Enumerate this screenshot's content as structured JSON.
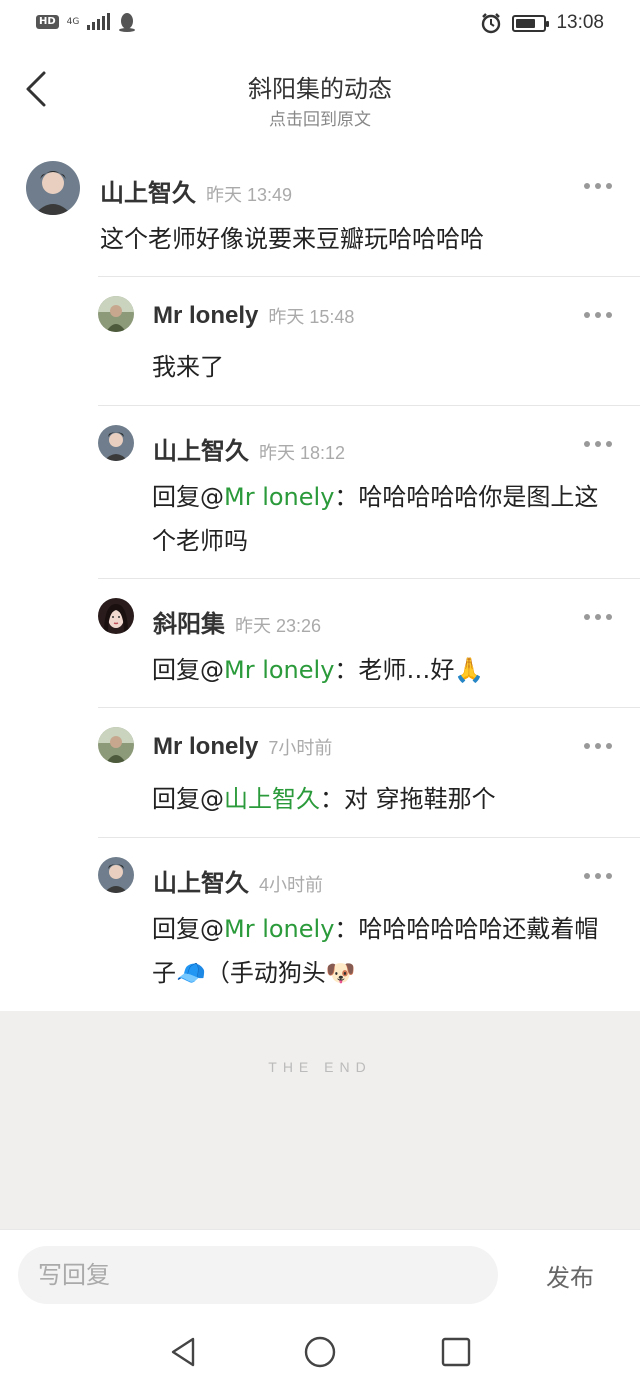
{
  "status_bar": {
    "hd": "HD",
    "network": "4G",
    "time": "13:08",
    "battery_level": 0.7
  },
  "header": {
    "title": "斜阳集的动态",
    "subtitle": "点击回到原文"
  },
  "main_comment": {
    "author": "山上智久",
    "time": "昨天 13:49",
    "text": "这个老师好像说要来豆瓣玩哈哈哈哈"
  },
  "replies": [
    {
      "author": "Mr lonely",
      "time": "昨天 15:48",
      "prefix": "",
      "mention": "",
      "sep": "",
      "text": "我来了"
    },
    {
      "author": "山上智久",
      "time": "昨天 18:12",
      "prefix": "回复@",
      "mention": "Mr lonely",
      "sep": "：",
      "text": "哈哈哈哈哈你是图上这个老师吗"
    },
    {
      "author": "斜阳集",
      "time": "昨天 23:26",
      "prefix": "回复@",
      "mention": "Mr lonely",
      "sep": "：",
      "text": "老师…好🙏"
    },
    {
      "author": "Mr lonely",
      "time": "7小时前",
      "prefix": "回复@",
      "mention": "山上智久",
      "sep": "：",
      "text": "对 穿拖鞋那个"
    },
    {
      "author": "山上智久",
      "time": "4小时前",
      "prefix": "回复@",
      "mention": "Mr lonely",
      "sep": "：",
      "text": "哈哈哈哈哈哈还戴着帽子🧢（手动狗头🐶"
    }
  ],
  "end_marker": "THE END",
  "composer": {
    "placeholder": "写回复",
    "send_label": "发布"
  },
  "colors": {
    "mention": "#2a9a3a",
    "end_background": "#f0efed"
  }
}
